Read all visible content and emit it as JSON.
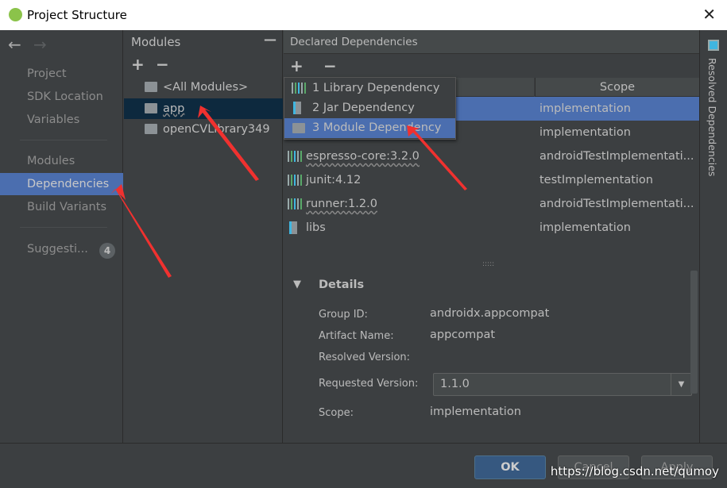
{
  "window": {
    "title": "Project Structure",
    "close": "✕"
  },
  "sidebar": {
    "back": "←",
    "forward": "→",
    "items": [
      {
        "label": "Project"
      },
      {
        "label": "SDK Location"
      },
      {
        "label": "Variables"
      },
      {
        "label": "Modules"
      },
      {
        "label": "Dependencies",
        "selected": true
      },
      {
        "label": "Build Variants"
      },
      {
        "label": "Suggesti..."
      }
    ],
    "suggestions_count": "4"
  },
  "modules": {
    "title": "Modules",
    "collapse": "—",
    "add": "+",
    "remove": "−",
    "items": [
      {
        "label": "<All Modules>"
      },
      {
        "label": "app",
        "selected": true
      },
      {
        "label": "openCVLibrary349"
      }
    ]
  },
  "declared": {
    "title": "Declared Dependencies",
    "add": "+",
    "remove": "−",
    "columns": [
      "",
      "Scope"
    ],
    "rows": [
      {
        "name": "",
        "scope": "implementation",
        "icon": "library-icon",
        "selected": true
      },
      {
        "name": "",
        "scope": "implementation",
        "icon": "library-icon"
      },
      {
        "name": "espresso-core:3.2.0",
        "scope": "androidTestImplementati...",
        "icon": "library-icon"
      },
      {
        "name": "junit:4.12",
        "scope": "testImplementation",
        "icon": "library-icon"
      },
      {
        "name": "runner:1.2.0",
        "scope": "androidTestImplementati...",
        "icon": "library-icon"
      },
      {
        "name": "libs",
        "scope": "implementation",
        "icon": "jar-icon"
      }
    ]
  },
  "popup": {
    "items": [
      {
        "label": "1  Library Dependency"
      },
      {
        "label": "2  Jar Dependency"
      },
      {
        "label": "3  Module Dependency",
        "selected": true
      }
    ]
  },
  "details": {
    "title": "Details",
    "group_id_label": "Group ID:",
    "group_id": "androidx.appcompat",
    "artifact_label": "Artifact Name:",
    "artifact": "appcompat",
    "resolved_label": "Resolved Version:",
    "requested_label": "Requested Version:",
    "requested": "1.1.0",
    "scope_label": "Scope:",
    "scope": "implementation"
  },
  "resolved_tab": "Resolved Dependencies",
  "buttons": {
    "ok": "OK",
    "cancel": "Cancel",
    "apply": "Apply"
  },
  "watermark": "https://blog.csdn.net/qumoy",
  "colors": {
    "selection": "#4b6eaf",
    "background": "#3c3f41",
    "annotation_arrow": "#f0312f"
  }
}
